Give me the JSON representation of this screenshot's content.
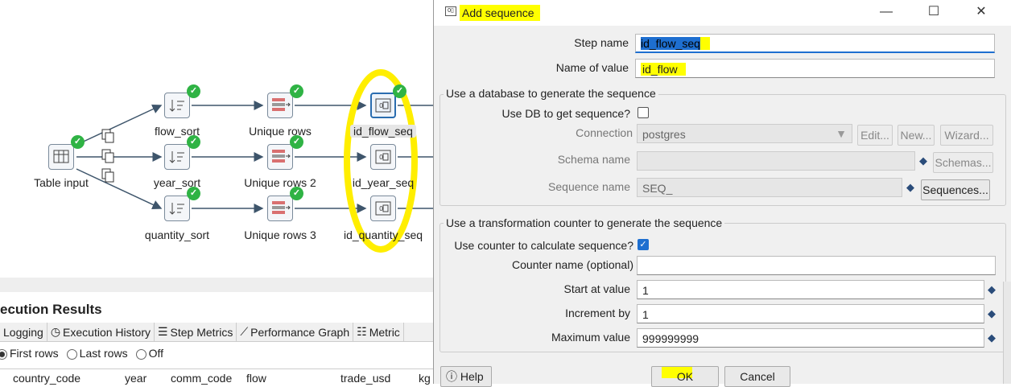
{
  "canvas": {
    "nodes": [
      {
        "label": "Table input"
      },
      {
        "label": "flow_sort"
      },
      {
        "label": "year_sort"
      },
      {
        "label": "quantity_sort"
      },
      {
        "label": "Unique rows"
      },
      {
        "label": "Unique rows 2"
      },
      {
        "label": "Unique rows 3"
      },
      {
        "label": "id_flow_seq"
      },
      {
        "label": "id_year_seq"
      },
      {
        "label": "id_quantity_seq"
      }
    ]
  },
  "results": {
    "title": "ecution Results",
    "tabs": [
      "Logging",
      "Execution History",
      "Step Metrics",
      "Performance Graph",
      "Metric"
    ],
    "radios": [
      "First rows",
      "Last rows",
      "Off"
    ],
    "columns": [
      "country_code",
      "year",
      "comm_code",
      "flow",
      "trade_usd",
      "kg"
    ]
  },
  "dialog": {
    "title": "Add sequence",
    "window_controls": {
      "minimize": "—",
      "maximize": "☐",
      "close": "✕"
    },
    "step_name_label": "Step name",
    "step_name_value": "id_flow_seq",
    "name_of_value_label": "Name of value",
    "name_of_value_value": "id_flow",
    "db_group": {
      "title": "Use a database to generate the sequence",
      "use_db_label": "Use DB to get sequence?",
      "use_db_checked": false,
      "connection_label": "Connection",
      "connection_value": "postgres",
      "edit_button": "Edit...",
      "new_button": "New...",
      "wizard_button": "Wizard...",
      "schema_label": "Schema name",
      "schema_value": "",
      "schemas_button": "Schemas...",
      "sequence_label": "Sequence name",
      "sequence_value": "SEQ_",
      "sequences_button": "Sequences..."
    },
    "counter_group": {
      "title": "Use a transformation counter to generate the sequence",
      "use_counter_label": "Use counter to calculate sequence?",
      "use_counter_checked": true,
      "counter_name_label": "Counter name (optional)",
      "counter_name_value": "",
      "start_label": "Start at value",
      "start_value": "1",
      "increment_label": "Increment by",
      "increment_value": "1",
      "max_label": "Maximum value",
      "max_value": "999999999"
    },
    "help_button": "Help",
    "ok_button": "OK",
    "cancel_button": "Cancel"
  },
  "colors": {
    "accent": "#1e6fd0",
    "highlight": "#ffff00",
    "success": "#2fb344"
  }
}
